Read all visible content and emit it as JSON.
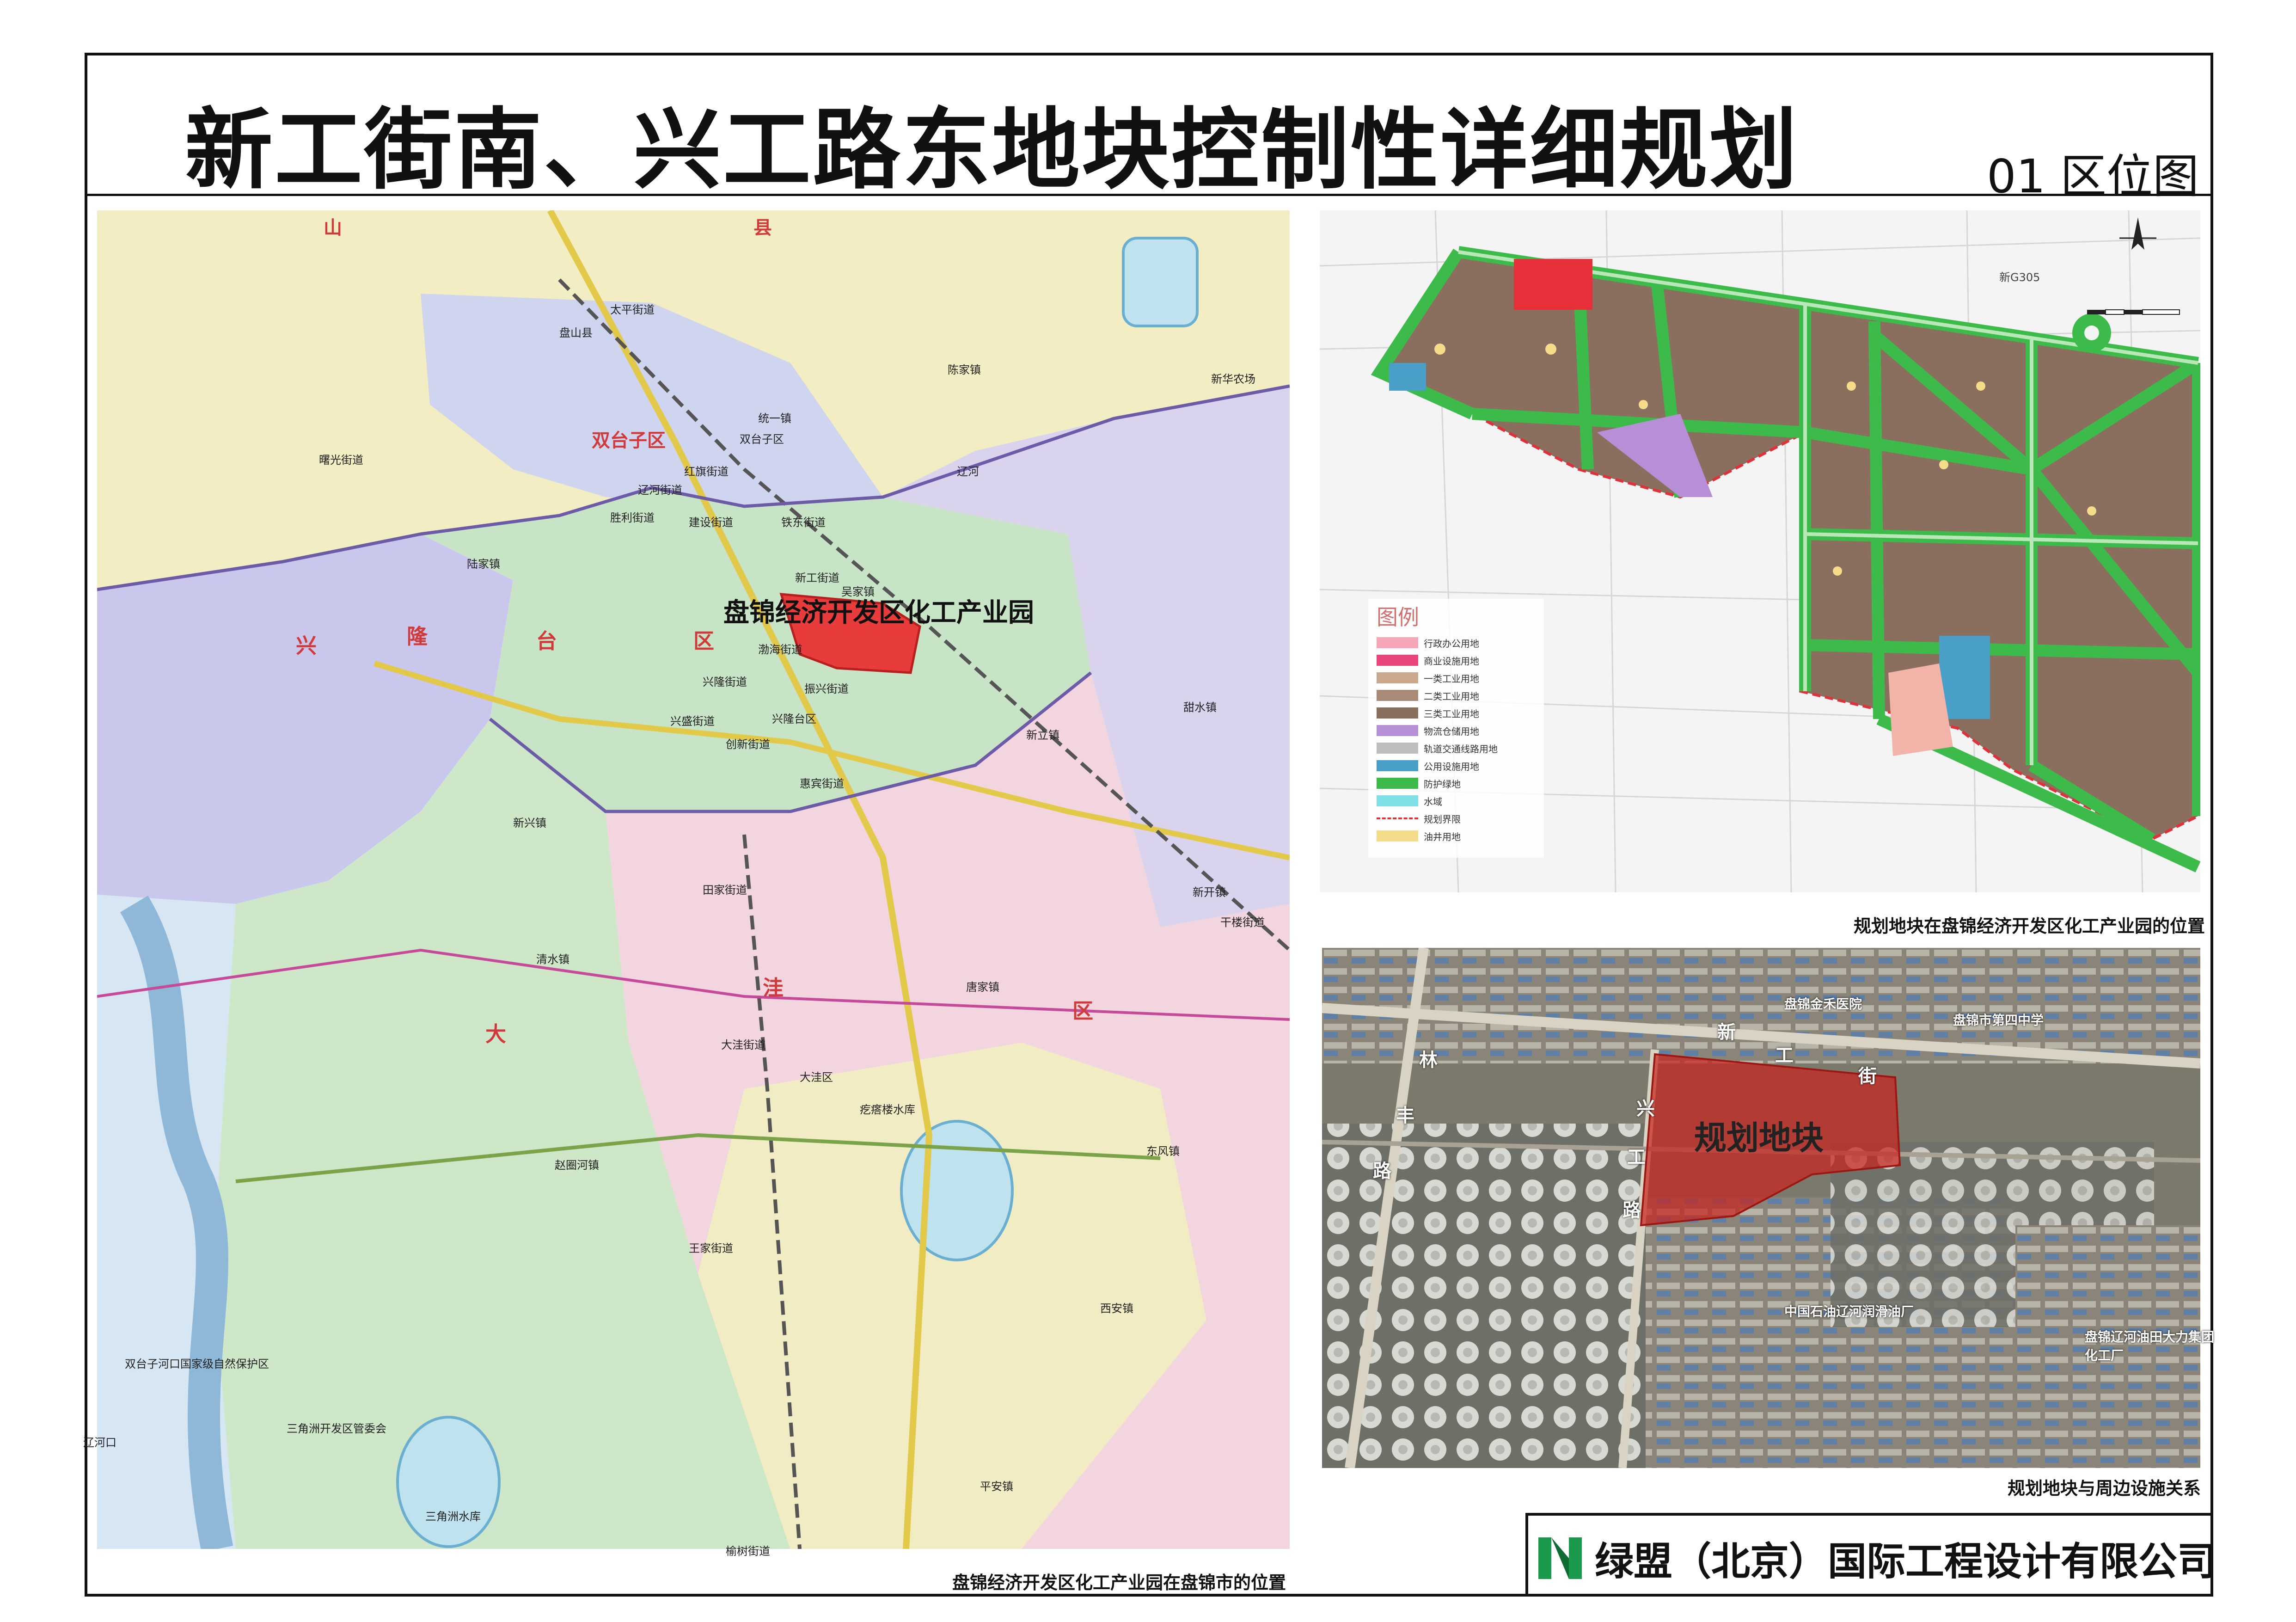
{
  "header": {
    "title": "新工街南、兴工路东地块控制性详细规划",
    "sheet_label": "01 区位图"
  },
  "regional_map": {
    "caption": "盘锦经济开发区化工产业园在盘锦市的位置",
    "site_label": "盘锦经济开发区化工产业园",
    "district_labels": [
      {
        "text": "双台子区"
      },
      {
        "text": "兴"
      },
      {
        "text": "隆"
      },
      {
        "text": "台"
      },
      {
        "text": "区"
      },
      {
        "text": "大"
      },
      {
        "text": "洼"
      },
      {
        "text": "区"
      },
      {
        "text": "山"
      },
      {
        "text": "县"
      }
    ],
    "place_labels": [
      {
        "text": "盘山县"
      },
      {
        "text": "太平街道"
      },
      {
        "text": "双台子区"
      },
      {
        "text": "陈家镇"
      },
      {
        "text": "统一镇"
      },
      {
        "text": "红旗街道"
      },
      {
        "text": "辽河街道"
      },
      {
        "text": "胜利街道"
      },
      {
        "text": "建设街道"
      },
      {
        "text": "铁东街道"
      },
      {
        "text": "新工街道"
      },
      {
        "text": "吴家镇"
      },
      {
        "text": "陆家镇"
      },
      {
        "text": "渤海街道"
      },
      {
        "text": "兴隆街道"
      },
      {
        "text": "振兴街道"
      },
      {
        "text": "兴盛街道"
      },
      {
        "text": "兴隆台区"
      },
      {
        "text": "创新街道"
      },
      {
        "text": "惠宾街道"
      },
      {
        "text": "新立镇"
      },
      {
        "text": "新兴镇"
      },
      {
        "text": "田家街道"
      },
      {
        "text": "新开镇"
      },
      {
        "text": "清水镇"
      },
      {
        "text": "唐家镇"
      },
      {
        "text": "大洼街道"
      },
      {
        "text": "大洼区"
      },
      {
        "text": "东风镇"
      },
      {
        "text": "赵圈河镇"
      },
      {
        "text": "王家街道"
      },
      {
        "text": "西安镇"
      },
      {
        "text": "平安镇"
      },
      {
        "text": "榆树街道"
      },
      {
        "text": "三角洲开发区管委会"
      },
      {
        "text": "双台子河口国家级自然保护区"
      },
      {
        "text": "辽河口"
      },
      {
        "text": "疙瘩楼水库"
      },
      {
        "text": "三角洲水库"
      },
      {
        "text": "新华农场"
      },
      {
        "text": "曙光街道"
      },
      {
        "text": "甜水镇"
      },
      {
        "text": "干楼街道"
      },
      {
        "text": "辽河"
      }
    ],
    "colors": {
      "panjin_district_blue": "#c9c8ec",
      "xinglongtai_green": "#c6e4c6",
      "dawa_pink": "#f4d3dd",
      "panshan_yellow": "#f2ecc0",
      "site_red": "#e83b3b"
    }
  },
  "land_use_map": {
    "caption": "规划地块在盘锦经济开发区化工产业园的位置",
    "labels": [
      "新G305"
    ],
    "legend_title": "图例",
    "legend": [
      {
        "label": "行政办公用地",
        "color": "#f5a7b8"
      },
      {
        "label": "商业设施用地",
        "color": "#e8457a"
      },
      {
        "label": "一类工业用地",
        "color": "#c9a88e"
      },
      {
        "label": "二类工业用地",
        "color": "#a98a76"
      },
      {
        "label": "三类工业用地",
        "color": "#8b6f5e"
      },
      {
        "label": "物流仓储用地",
        "color": "#b78fd6"
      },
      {
        "label": "轨道交通线路用地",
        "color": "#bdbdbd"
      },
      {
        "label": "公用设施用地",
        "color": "#4a9fc9"
      },
      {
        "label": "防护绿地",
        "color": "#3dbb4a"
      },
      {
        "label": "水域",
        "color": "#7fe0e8"
      },
      {
        "label": "规划界限",
        "color": "#e0303a"
      },
      {
        "label": "油井用地",
        "color": "#f5dc8a"
      }
    ]
  },
  "satellite_map": {
    "caption": "规划地块与周边设施关系",
    "site_label": "规划地块",
    "street_labels": [
      {
        "text": "新"
      },
      {
        "text": "工"
      },
      {
        "text": "街"
      },
      {
        "text": "兴"
      },
      {
        "text": "工"
      },
      {
        "text": "路"
      },
      {
        "text": "林"
      },
      {
        "text": "丰"
      },
      {
        "text": "路"
      }
    ],
    "poi_labels": [
      {
        "text": "盘锦金禾医院"
      },
      {
        "text": "盘锦市第四中学"
      },
      {
        "text": "中国石油辽河润滑油厂"
      },
      {
        "text": "盘锦辽河油田大力集团化工厂"
      }
    ]
  },
  "footer": {
    "company": "绿盟（北京）国际工程设计有限公司",
    "logo_colors": [
      "#1a9a4a",
      "#0f6b34"
    ]
  }
}
